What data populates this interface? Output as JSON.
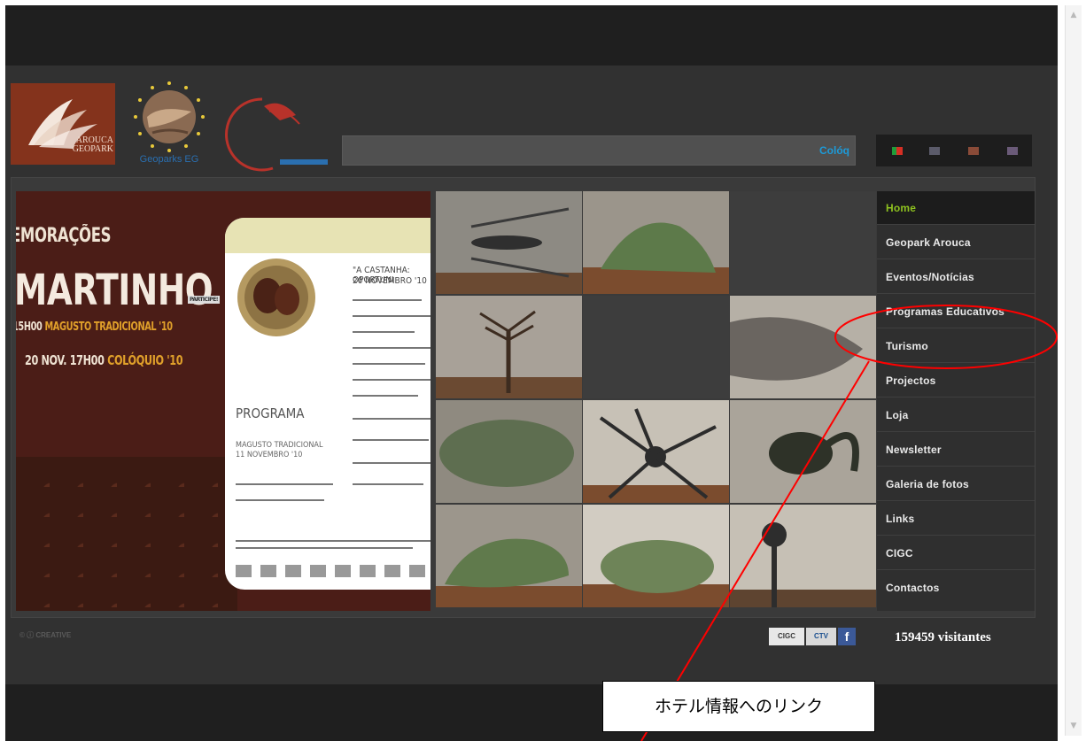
{
  "header": {
    "logo_geopark_text": "AROUCA GEOPARK",
    "logo_egn_text": "Geoparks EG",
    "search_ticker": "Colóq"
  },
  "languages": [
    {
      "name": "pt-flag-icon",
      "color": "#1f9d3a"
    },
    {
      "name": "en-flag-icon",
      "color": "#5b5b6a"
    },
    {
      "name": "es-flag-icon",
      "color": "#8a4b38"
    },
    {
      "name": "fr-flag-icon",
      "color": "#6a5a78"
    }
  ],
  "poster": {
    "top_line": "EMORAÇÕES",
    "title": "MARTINHO",
    "participe": "PARTICIPE!",
    "magusto_prefix": "15H00 ",
    "magusto_highlight": "MAGUSTO TRADICIONAL '10",
    "date_prefix": "20 NOV. 17H00 ",
    "date_highlight": "COLÓQUIO '10",
    "leaflet_heading": "\"A CASTANHA: OPORTUNI",
    "leaflet_date": "20 NOVEMBRO '10",
    "leaflet_programa": "PROGRAMA",
    "leaflet_sub": "MAGUSTO TRADICIONAL",
    "leaflet_sub_date": "11 NOVEMBRO '10"
  },
  "menu": {
    "items": [
      {
        "label": "Home",
        "active": true
      },
      {
        "label": "Geopark Arouca",
        "active": false
      },
      {
        "label": "Eventos/Notícias",
        "active": false
      },
      {
        "label": "Programas Educativos",
        "active": false
      },
      {
        "label": "Turismo",
        "active": false
      },
      {
        "label": "Projectos",
        "active": false
      },
      {
        "label": "Loja",
        "active": false
      },
      {
        "label": "Newsletter",
        "active": false
      },
      {
        "label": "Galeria de fotos",
        "active": false
      },
      {
        "label": "Links",
        "active": false
      },
      {
        "label": "CIGC",
        "active": false
      },
      {
        "label": "Contactos",
        "active": false
      }
    ]
  },
  "footer": {
    "creative_commons": "© ⓘ CREATIVE",
    "badges": [
      "CIGC",
      "CTV",
      "f"
    ],
    "visitors": "159459 visitantes"
  },
  "annotation": {
    "label": "ホテル情報へのリンク",
    "color": "#ff0000"
  }
}
